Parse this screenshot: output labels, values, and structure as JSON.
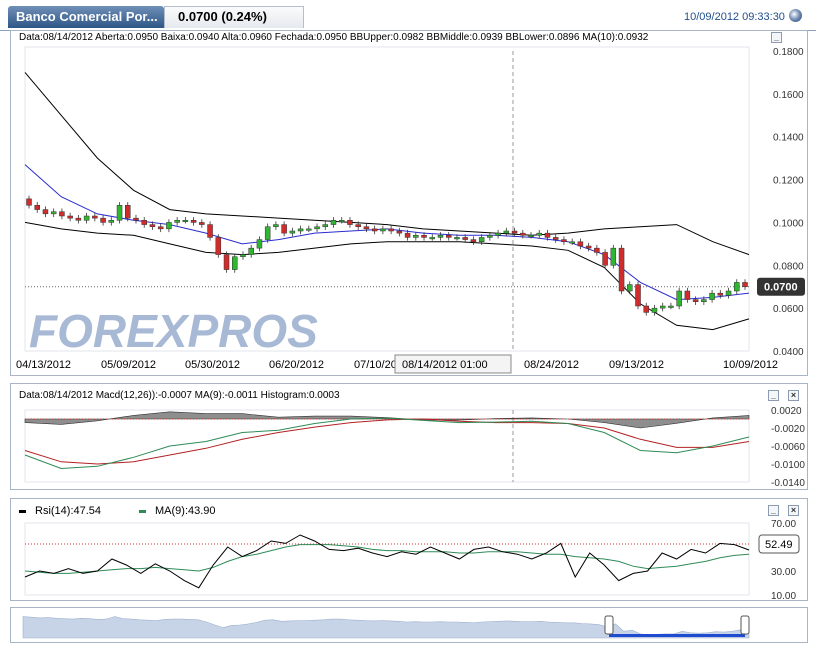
{
  "header": {
    "instrument": "Banco Comercial Por...",
    "price": "0.0700 (0.24%)",
    "datetime": "10/09/2012 09:33:30"
  },
  "main_chart": {
    "info": "Data:08/14/2012 Aberta:0.0950 Baixa:0.0940 Alta:0.0960 Fechada:0.0950 BBUpper:0.0982 BBMiddle:0.0939 BBLower:0.0896 MA(10):0.0932",
    "watermark": "FOREXPROS",
    "last_price_label": "0.0700",
    "crosshair_label": "08/14/2012 01:00",
    "ctrl_minimize": "_"
  },
  "macd_panel": {
    "info": "Data:08/14/2012 Macd(12,26)):-0.0007 MA(9):-0.0011 Histogram:0.0003",
    "ctrl_minimize": "_",
    "ctrl_close": "×"
  },
  "rsi_panel": {
    "legend_rsi": "Rsi(14):47.54",
    "legend_ma": "MA(9):43.90",
    "last_label": "52.49",
    "ctrl_minimize": "_",
    "ctrl_close": "×"
  },
  "colors": {
    "header_tab": "#2d5687",
    "candle_up": "#2fb52f",
    "candle_down": "#d12c2c",
    "bollinger": "#000000",
    "ma10": "#2b2bd1",
    "macd": "#2e8b57",
    "macd_signal": "#b22222",
    "rsi": "#000000",
    "rsi_ma": "#2e8b57",
    "navigator_fill": "#c7d3e6",
    "navigator_selection": "#1f4bd1"
  },
  "chart_data": [
    {
      "type": "candlestick",
      "x_tick_labels": [
        "04/13/2012",
        "05/09/2012",
        "05/30/2012",
        "06/20/2012",
        "07/10/2012",
        "08/24/2012",
        "09/13/2012",
        "10/09/2012"
      ],
      "y_tick_labels": [
        "0.1800",
        "0.1600",
        "0.1400",
        "0.1200",
        "0.1000",
        "0.0800",
        "0.0600",
        "0.0400"
      ],
      "ylim": [
        0.04,
        0.18
      ],
      "last_close": 0.07,
      "crosshair_date": "08/14/2012",
      "reference_line": 0.07,
      "series": [
        {
          "name": "Close",
          "values": [
            0.108,
            0.106,
            0.104,
            0.105,
            0.103,
            0.102,
            0.101,
            0.103,
            0.102,
            0.1,
            0.101,
            0.108,
            0.102,
            0.101,
            0.099,
            0.098,
            0.097,
            0.1,
            0.101,
            0.101,
            0.1,
            0.099,
            0.093,
            0.085,
            0.078,
            0.084,
            0.085,
            0.088,
            0.092,
            0.098,
            0.099,
            0.095,
            0.096,
            0.097,
            0.097,
            0.098,
            0.099,
            0.101,
            0.101,
            0.099,
            0.098,
            0.097,
            0.096,
            0.097,
            0.096,
            0.095,
            0.093,
            0.094,
            0.093,
            0.093,
            0.094,
            0.093,
            0.093,
            0.092,
            0.091,
            0.093,
            0.094,
            0.095,
            0.096,
            0.095,
            0.094,
            0.094,
            0.095,
            0.093,
            0.092,
            0.091,
            0.091,
            0.089,
            0.088,
            0.086,
            0.08,
            0.088,
            0.068,
            0.071,
            0.061,
            0.058,
            0.06,
            0.061,
            0.061,
            0.068,
            0.064,
            0.063,
            0.064,
            0.067,
            0.066,
            0.068,
            0.072,
            0.07
          ]
        },
        {
          "name": "BBUpper",
          "values": [
            0.17,
            0.15,
            0.13,
            0.115,
            0.106,
            0.104,
            0.103,
            0.102,
            0.101,
            0.1,
            0.099,
            0.097,
            0.096,
            0.095,
            0.094,
            0.095,
            0.097,
            0.098,
            0.099,
            0.091,
            0.085
          ]
        },
        {
          "name": "BBLower",
          "values": [
            0.1,
            0.097,
            0.095,
            0.094,
            0.09,
            0.086,
            0.085,
            0.086,
            0.088,
            0.09,
            0.091,
            0.091,
            0.091,
            0.09,
            0.089,
            0.087,
            0.079,
            0.062,
            0.052,
            0.05,
            0.055
          ]
        },
        {
          "name": "MA(10)",
          "values": [
            0.127,
            0.112,
            0.104,
            0.101,
            0.099,
            0.095,
            0.09,
            0.092,
            0.095,
            0.096,
            0.097,
            0.095,
            0.094,
            0.094,
            0.093,
            0.091,
            0.085,
            0.072,
            0.064,
            0.065,
            0.067
          ]
        }
      ]
    },
    {
      "type": "line",
      "y_tick_labels": [
        "0.0020",
        "-0.0020",
        "-0.0060",
        "-0.0100",
        "-0.0140"
      ],
      "ylim": [
        -0.014,
        0.002
      ],
      "series": [
        {
          "name": "Macd",
          "values": [
            -0.008,
            -0.011,
            -0.0105,
            -0.0085,
            -0.006,
            -0.005,
            -0.003,
            -0.0025,
            -0.001,
            0.0,
            0.0002,
            -0.0003,
            -0.0008,
            -0.0007,
            -0.0005,
            -0.001,
            -0.003,
            -0.007,
            -0.0075,
            -0.006,
            -0.004
          ]
        },
        {
          "name": "MA(9)",
          "values": [
            -0.007,
            -0.0095,
            -0.01,
            -0.0095,
            -0.008,
            -0.0065,
            -0.0045,
            -0.003,
            -0.0018,
            -0.0008,
            -0.0002,
            0.0,
            -0.0005,
            -0.0008,
            -0.0008,
            -0.001,
            -0.002,
            -0.0045,
            -0.0063,
            -0.0063,
            -0.005
          ]
        },
        {
          "name": "Histogram",
          "values": [
            -0.001,
            -0.0015,
            -0.0005,
            0.001,
            0.002,
            0.0015,
            0.0015,
            0.0005,
            0.0008,
            0.0008,
            0.0004,
            -0.0003,
            -0.0003,
            0.0001,
            0.0003,
            0.0,
            -0.001,
            -0.0025,
            -0.0012,
            0.0003,
            0.001
          ]
        }
      ]
    },
    {
      "type": "line",
      "y_tick_labels": [
        "70.00",
        "30.00",
        "10.00"
      ],
      "ylim": [
        10,
        70
      ],
      "reference_line": 52.49,
      "series": [
        {
          "name": "Rsi(14)",
          "values": [
            25,
            30,
            28,
            32,
            28,
            30,
            40,
            35,
            28,
            36,
            30,
            22,
            16,
            35,
            50,
            42,
            47,
            55,
            53,
            60,
            55,
            48,
            47,
            49,
            45,
            42,
            46,
            44,
            50,
            45,
            40,
            48,
            50,
            46,
            44,
            40,
            45,
            53,
            25,
            45,
            35,
            22,
            28,
            30,
            45,
            40,
            48,
            45,
            53,
            52,
            47.54
          ]
        },
        {
          "name": "MA(9)",
          "values": [
            30,
            29,
            28,
            28,
            29,
            30,
            31,
            32,
            32,
            33,
            32,
            31,
            30,
            33,
            38,
            42,
            44,
            47,
            50,
            52,
            52,
            52,
            51,
            50,
            48,
            47,
            47,
            46,
            46,
            46,
            45,
            45,
            46,
            46,
            46,
            45,
            44,
            44,
            42,
            41,
            40,
            38,
            34,
            32,
            33,
            34,
            36,
            38,
            41,
            43,
            43.9
          ]
        }
      ]
    }
  ]
}
